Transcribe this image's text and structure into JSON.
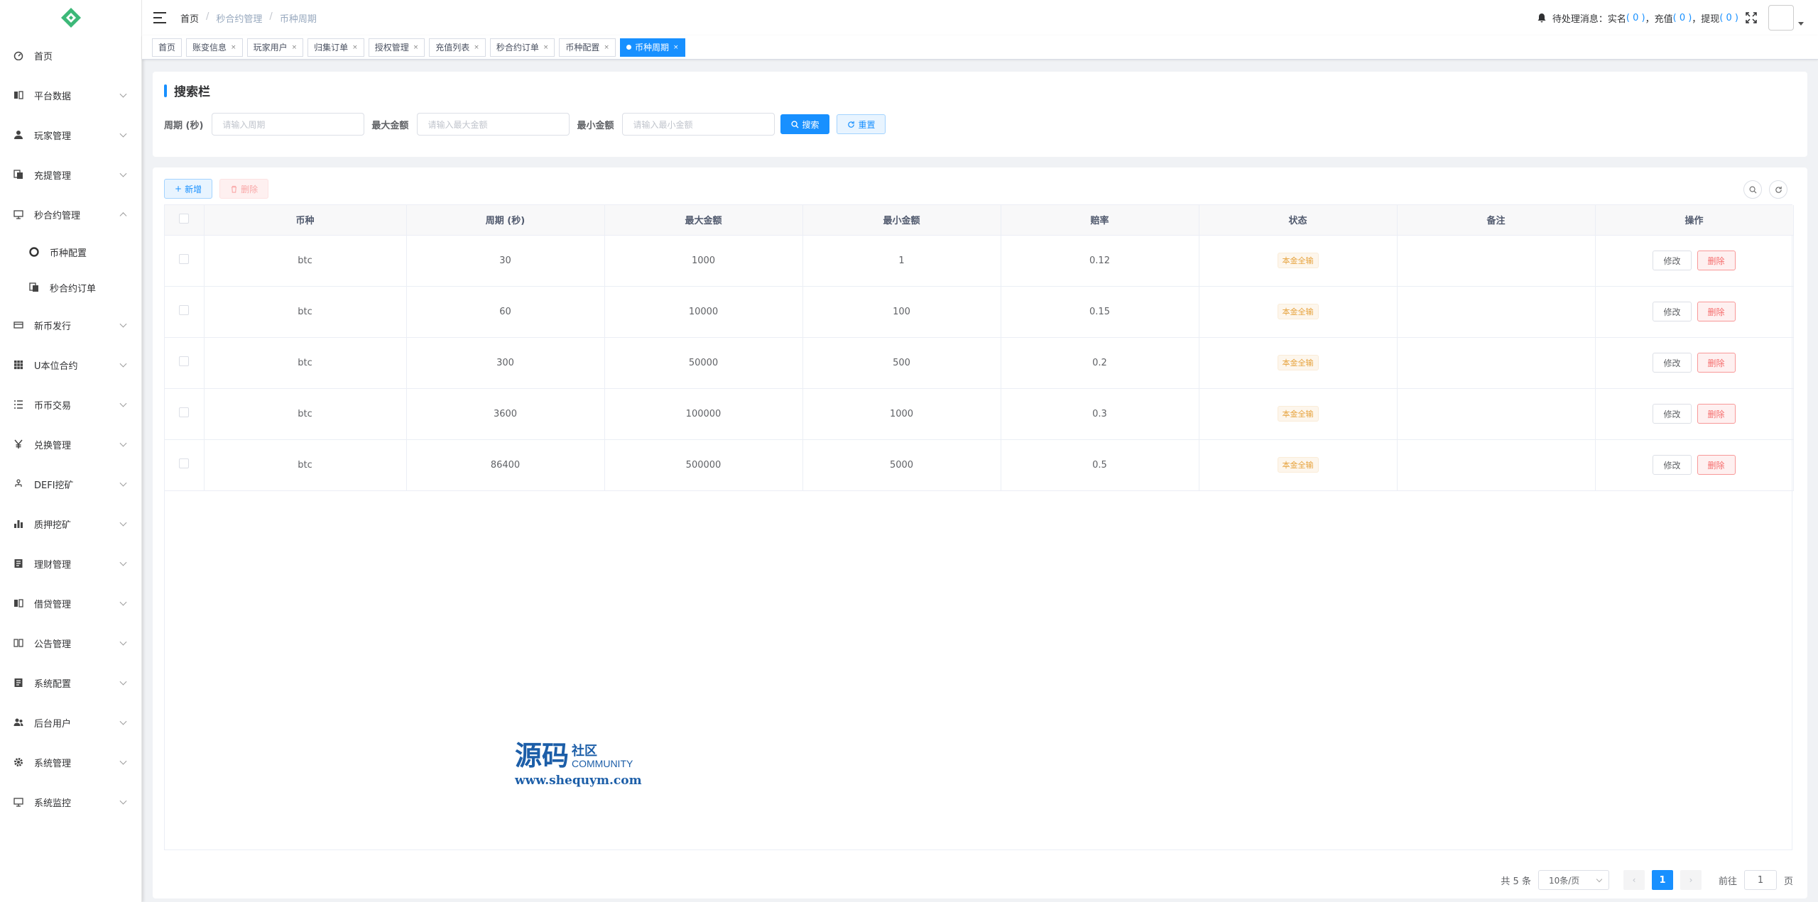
{
  "sidebar": {
    "items": [
      {
        "label": "首页",
        "icon": "dashboard-icon"
      },
      {
        "label": "平台数据",
        "icon": "data-icon"
      },
      {
        "label": "玩家管理",
        "icon": "user-icon"
      },
      {
        "label": "充提管理",
        "icon": "documents-icon"
      },
      {
        "label": "秒合约管理",
        "icon": "monitor-icon"
      },
      {
        "label": "币种配置",
        "icon": "gear-circle-icon"
      },
      {
        "label": "秒合约订单",
        "icon": "documents-icon"
      },
      {
        "label": "新币发行",
        "icon": "card-icon"
      },
      {
        "label": "U本位合约",
        "icon": "grid-icon"
      },
      {
        "label": "币币交易",
        "icon": "list-icon"
      },
      {
        "label": "兑换管理",
        "icon": "yen-icon"
      },
      {
        "label": "DEFI挖矿",
        "icon": "tree-icon"
      },
      {
        "label": "质押挖矿",
        "icon": "bar-chart-icon"
      },
      {
        "label": "理财管理",
        "icon": "report-icon"
      },
      {
        "label": "借贷管理",
        "icon": "data-icon"
      },
      {
        "label": "公告管理",
        "icon": "book-icon"
      },
      {
        "label": "系统配置",
        "icon": "report-icon"
      },
      {
        "label": "后台用户",
        "icon": "peoples-icon"
      },
      {
        "label": "系统管理",
        "icon": "gear-icon"
      },
      {
        "label": "系统监控",
        "icon": "monitor-icon"
      }
    ]
  },
  "navbar": {
    "breadcrumb": [
      "首页",
      "秒合约管理",
      "币种周期"
    ],
    "notice_prefix": "待处理消息：实名",
    "n1": "( 0 )",
    "mid1": "，充值",
    "n2": "( 0 )",
    "mid2": "，提现",
    "n3": "( 0 )"
  },
  "tags": [
    "首页",
    "账变信息",
    "玩家用户",
    "归集订单",
    "授权管理",
    "充值列表",
    "秒合约订单",
    "币种配置",
    "币种周期"
  ],
  "search": {
    "title": "搜索栏",
    "fields": [
      {
        "label": "周期 (秒)",
        "placeholder": "请输入周期"
      },
      {
        "label": "最大金额",
        "placeholder": "请输入最大金额"
      },
      {
        "label": "最小金额",
        "placeholder": "请输入最小金额"
      }
    ],
    "search_btn": "搜索",
    "reset_btn": "重置"
  },
  "toolbar": {
    "add": "新增",
    "delete": "删除"
  },
  "table": {
    "headers": [
      "币种",
      "周期 (秒)",
      "最大金额",
      "最小金额",
      "赔率",
      "状态",
      "备注",
      "操作"
    ],
    "rows": [
      {
        "coin": "btc",
        "period": "30",
        "max": "1000",
        "min": "1",
        "odds": "0.12",
        "status": "本金全输",
        "remark": ""
      },
      {
        "coin": "btc",
        "period": "60",
        "max": "10000",
        "min": "100",
        "odds": "0.15",
        "status": "本金全输",
        "remark": ""
      },
      {
        "coin": "btc",
        "period": "300",
        "max": "50000",
        "min": "500",
        "odds": "0.2",
        "status": "本金全输",
        "remark": ""
      },
      {
        "coin": "btc",
        "period": "3600",
        "max": "100000",
        "min": "1000",
        "odds": "0.3",
        "status": "本金全输",
        "remark": ""
      },
      {
        "coin": "btc",
        "period": "86400",
        "max": "500000",
        "min": "5000",
        "odds": "0.5",
        "status": "本金全输",
        "remark": ""
      }
    ],
    "edit_label": "修改",
    "delete_label": "删除"
  },
  "watermark": {
    "main": "源码",
    "side1": "社区",
    "side2": "COMMUNITY",
    "url": "www.shequym.com"
  },
  "pager": {
    "total": "共 5 条",
    "size": "10条/页",
    "page": "1",
    "goto_prefix": "前往",
    "goto_value": "1",
    "goto_suffix": "页"
  },
  "colors": {
    "primary": "#1890ff",
    "warning": "#e6a23c",
    "danger": "#f56c6c"
  }
}
